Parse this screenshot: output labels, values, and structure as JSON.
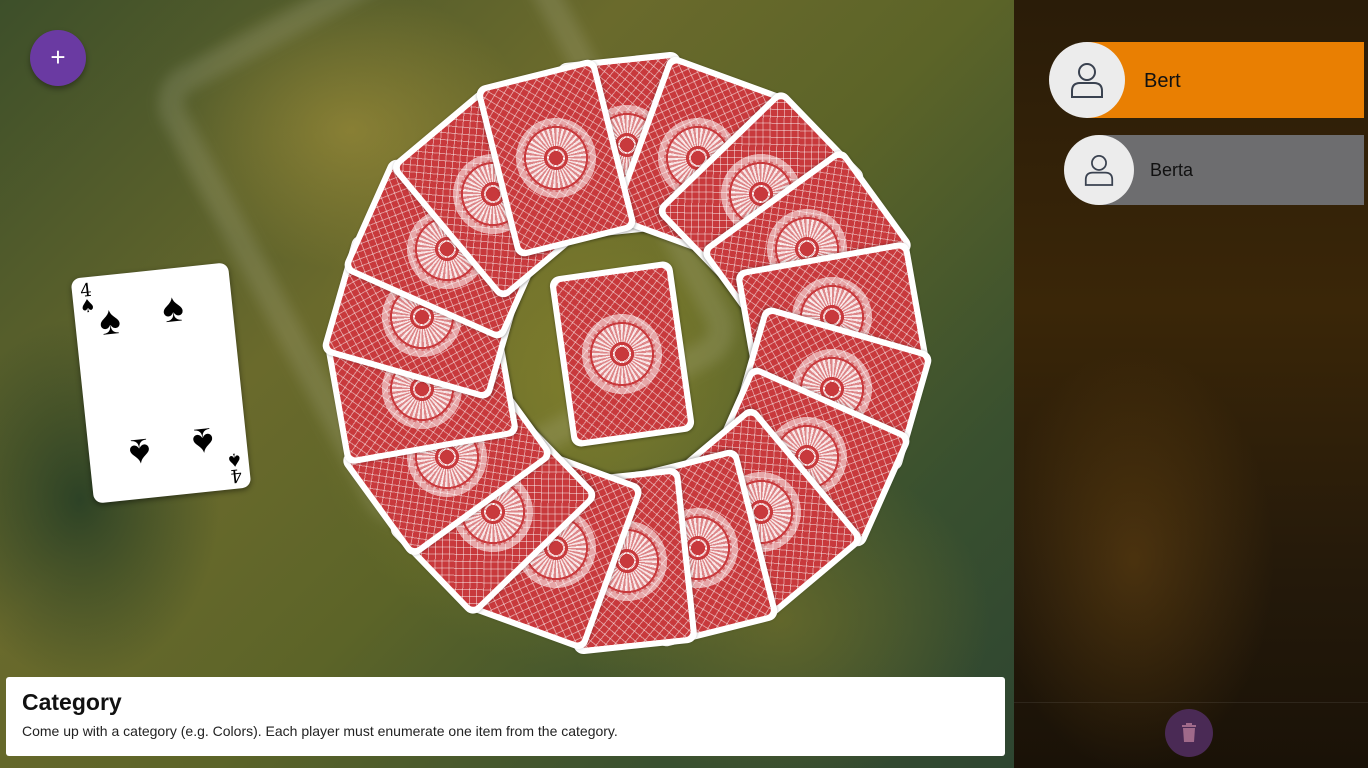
{
  "add_button": {
    "label": "+",
    "icon": "plus-icon"
  },
  "players": [
    {
      "name": "Bert",
      "active": true,
      "color": "#e97f02",
      "icon": "user-icon"
    },
    {
      "name": "Berta",
      "active": false,
      "color": "#6d6d6f",
      "icon": "user-icon"
    }
  ],
  "face_card": {
    "rank": "4",
    "suit": "♠",
    "suit_name": "spades"
  },
  "ring": {
    "card_count": 18,
    "card_back_color": "#c8393c"
  },
  "draw_pile": {
    "card_back_color": "#c8393c"
  },
  "info_panel": {
    "title": "Category",
    "description": "Come up with a category (e.g. Colors). Each player must enumerate one item from the category."
  },
  "delete_button": {
    "icon": "trash-icon",
    "color": "#4a2a55"
  }
}
